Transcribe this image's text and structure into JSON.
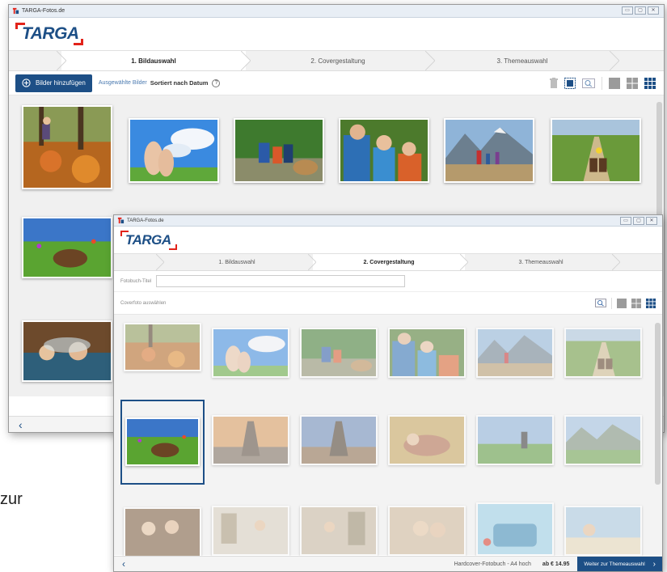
{
  "back_window": {
    "title": "TARGA-Fotos.de",
    "window_buttons": [
      "▭",
      "▢",
      "✕"
    ],
    "brand": "TARGA",
    "steps": [
      "1. Bildauswahl",
      "2. Covergestaltung",
      "3. Themeauswahl"
    ],
    "active_step": 0,
    "add_button_label": "Bilder hinzufügen",
    "selected_label": "Ausgewählte Bilder",
    "sort_label": "Sortiert nach Datum",
    "help_label": "?",
    "prev_arrow": "‹"
  },
  "front_window": {
    "title": "TARGA-Fotos.de",
    "window_buttons": [
      "▭",
      "▢",
      "✕"
    ],
    "brand": "TARGA",
    "steps": [
      "1. Bildauswahl",
      "2. Covergestaltung",
      "3. Themeauswahl"
    ],
    "active_step": 1,
    "title_field_label": "Fotobuch-Titel",
    "title_field_value": "",
    "cover_select_label": "Coverfoto auswählen",
    "footer": {
      "prev_arrow": "‹",
      "product": "Hardcover-Fotobuch - A4 hoch",
      "price": "ab € 14.95",
      "next_button": "Weiter zur Themeauswahl",
      "next_arrow": "›"
    }
  },
  "partial_text": "zur",
  "colors": {
    "brand_blue": "#1d4f86",
    "brand_red": "#e2231a",
    "selection_border": "#1d4f86"
  },
  "icons": [
    "trash-icon",
    "select-all-icon",
    "zoom-icon",
    "large-view-icon",
    "medium-view-icon",
    "small-view-icon",
    "add-circle-icon",
    "help-icon"
  ]
}
